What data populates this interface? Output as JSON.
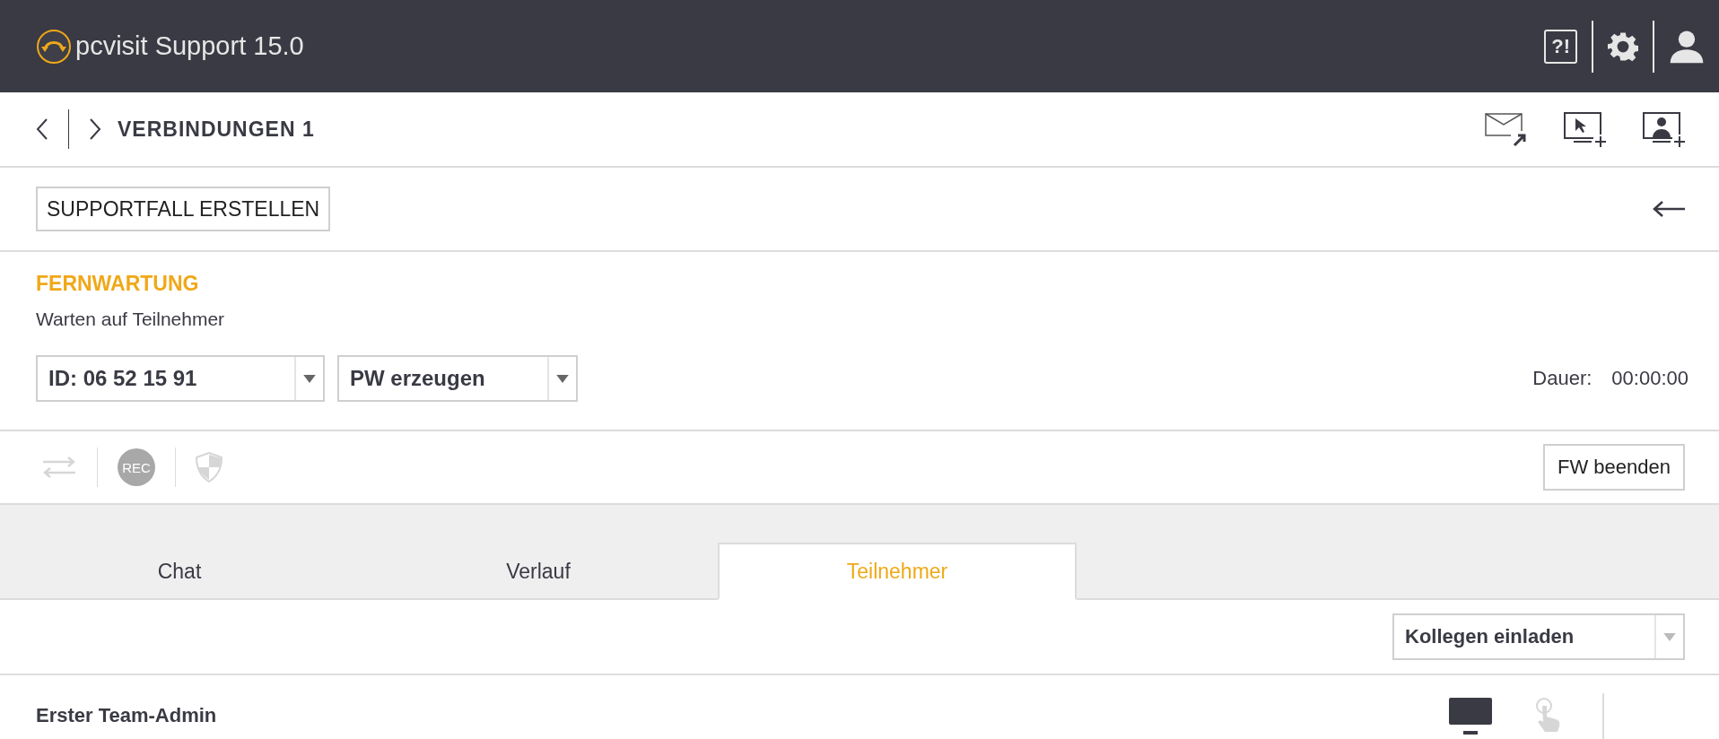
{
  "app": {
    "title": "pcvisit Support 15.0",
    "help_text": "?!"
  },
  "nav": {
    "title": "VERBINDUNGEN 1"
  },
  "case_button": "SUPPORTFALL ERSTELLEN",
  "session": {
    "title": "FERNWARTUNG",
    "status": "Warten auf Teilnehmer",
    "id_select": "ID: 06 52 15 91",
    "pw_select": "PW erzeugen",
    "duration_label": "Dauer:",
    "duration": "00:00:00"
  },
  "tools": [
    {
      "kind": "switch",
      "disabled": true
    },
    {
      "kind": "record",
      "label": "REC",
      "disabled": true
    },
    {
      "kind": "shield",
      "disabled": true
    }
  ],
  "end_button": "FW beenden",
  "tabs": [
    {
      "label": "Chat",
      "selected": false
    },
    {
      "label": "Verlauf",
      "selected": false
    },
    {
      "label": "Teilnehmer",
      "selected": true
    }
  ],
  "invite_select": "Kollegen einladen",
  "participants": [
    {
      "name": "Erster Team-Admin",
      "screen_on": true,
      "control_on": false
    }
  ]
}
